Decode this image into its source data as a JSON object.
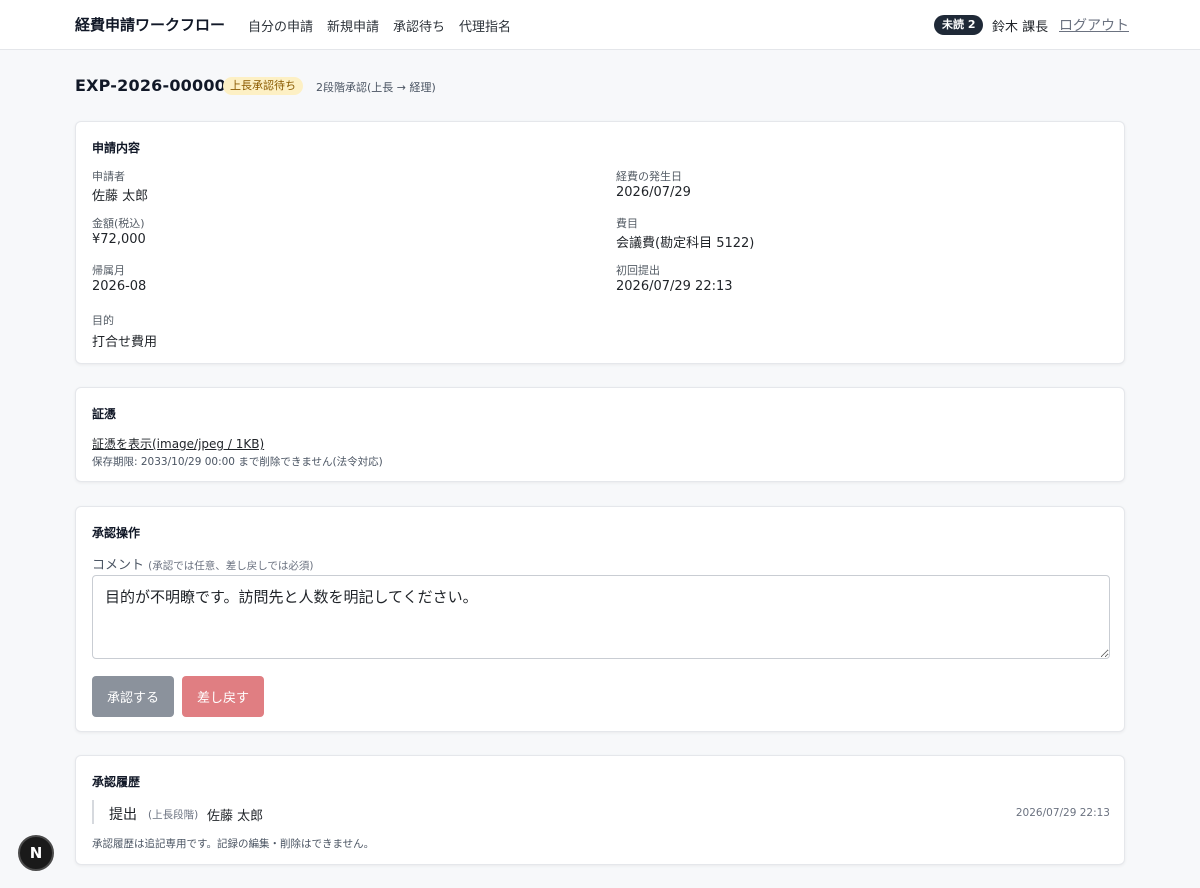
{
  "header": {
    "brand": "経費申請ワークフロー",
    "nav": [
      "自分の申請",
      "新規申請",
      "承認待ち",
      "代理指名"
    ],
    "unread_label": "未読 2",
    "user_name": "鈴木 課長",
    "logout_label": "ログアウト"
  },
  "request": {
    "id": "EXP-2026-000002",
    "status": "上長承認待ち",
    "flow": "2段階承認(上長 → 経理)"
  },
  "details": {
    "title": "申請内容",
    "applicant_label": "申請者",
    "applicant_value": "佐藤 太郎",
    "amount_label": "金額(税込)",
    "amount_value": "¥72,000",
    "period_label": "帰属月",
    "period_value": "2026-08",
    "purpose_label": "目的",
    "purpose_value": "打合せ費用",
    "date_label": "経費の発生日",
    "date_value": "2026/07/29",
    "category_label": "費目",
    "category_value": "会議費(勘定科目 5122)",
    "submitted_label": "初回提出",
    "submitted_value": "2026/07/29 22:13"
  },
  "evidence": {
    "title": "証憑",
    "link_label": "証憑を表示(image/jpeg / 1KB)",
    "retention_note": "保存期限: 2033/10/29 00:00 まで削除できません(法令対応)"
  },
  "approval": {
    "title": "承認操作",
    "comment_label": "コメント",
    "comment_hint": "(承認では任意、差し戻しでは必須)",
    "comment_value": "目的が不明瞭です。訪問先と人数を明記してください。",
    "approve_label": "承認する",
    "reject_label": "差し戻す"
  },
  "history": {
    "title": "承認履歴",
    "entries": [
      {
        "action": "提出",
        "stage": "(上長段階)",
        "actor": "佐藤 太郎",
        "time": "2026/07/29 22:13"
      }
    ],
    "note": "承認履歴は追記専用です。記録の編集・削除はできません。"
  },
  "dev_badge": "N",
  "colors": {
    "status_badge_bg": "#fdf0c4",
    "approve_button": "#8b929c",
    "reject_button": "#e07e82",
    "unread_badge": "#1f2937"
  }
}
